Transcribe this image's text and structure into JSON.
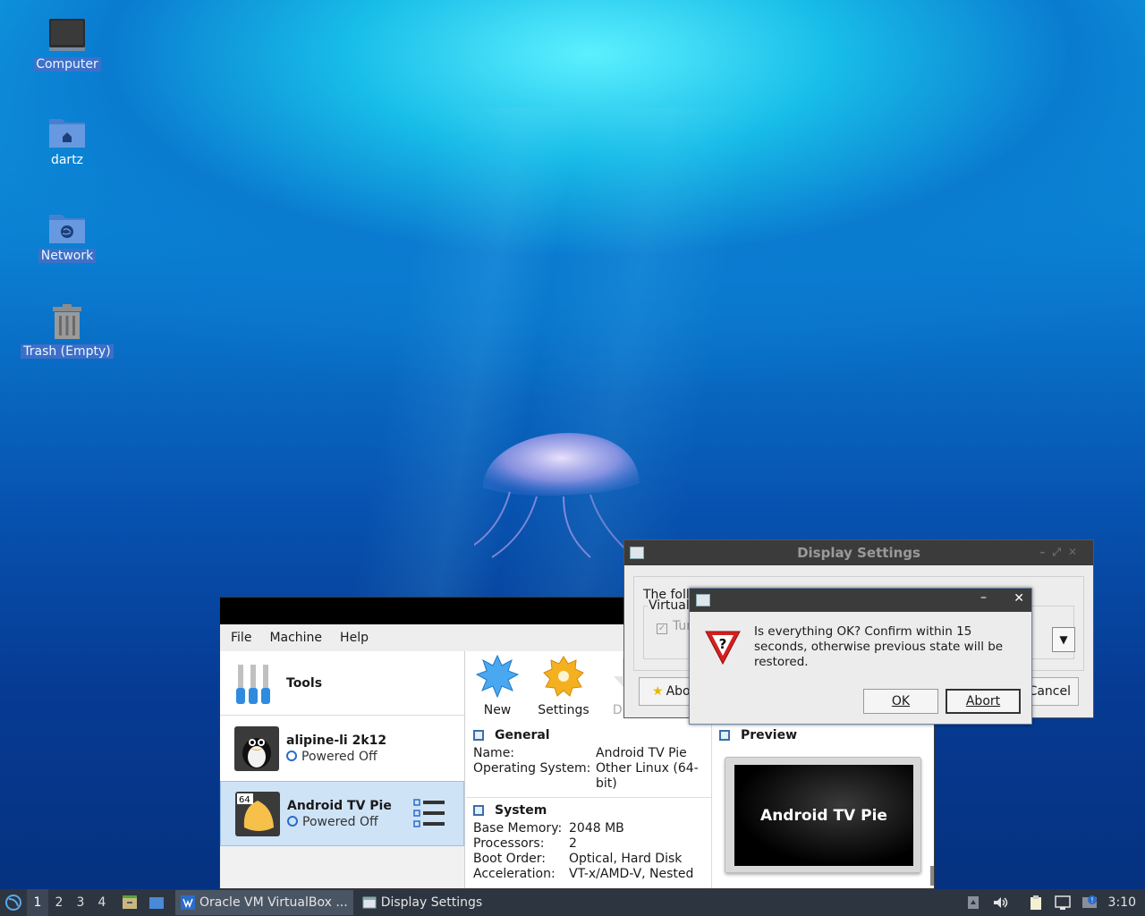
{
  "desktop": {
    "icons": [
      {
        "label": "Computer"
      },
      {
        "label": "dartz"
      },
      {
        "label": "Network"
      },
      {
        "label": "Trash (Empty)"
      }
    ]
  },
  "vbox": {
    "menu": [
      "File",
      "Machine",
      "Help"
    ],
    "tools_label": "Tools",
    "vms": [
      {
        "name": "alipine-li 2k12",
        "state": "Powered Off"
      },
      {
        "name": "Android TV Pie",
        "state": "Powered Off",
        "badge": "64"
      }
    ],
    "toolbar": {
      "new": "New",
      "settings": "Settings",
      "discard": "Disca"
    },
    "general": {
      "heading": "General",
      "name_label": "Name:",
      "name_value": "Android TV Pie",
      "os_label": "Operating System:",
      "os_value": "Other Linux (64-bit)"
    },
    "system": {
      "heading": "System",
      "mem_label": "Base Memory:",
      "mem_value": "2048 MB",
      "proc_label": "Processors:",
      "proc_value": "2",
      "boot_label": "Boot Order:",
      "boot_value": "Optical, Hard Disk",
      "accel_label": "Acceleration:",
      "accel_value": "VT-x/AMD-V, Nested"
    },
    "preview": {
      "heading": "Preview",
      "screen_text": "Android TV Pie"
    }
  },
  "display_settings": {
    "title": "Display Settings",
    "intro_text": "The foll",
    "group_label": "Virtual-",
    "checkbox_label": "Tur",
    "about_label": "Abo",
    "cancel_label": "Cancel"
  },
  "confirm": {
    "message": "Is everything OK? Confirm within 15 seconds, otherwise previous state will be restored.",
    "ok_label": "OK",
    "abort_label": "Abort"
  },
  "taskbar": {
    "workspaces": [
      "1",
      "2",
      "3",
      "4"
    ],
    "tasks": [
      {
        "label": "Oracle VM VirtualBox ...",
        "icon": "virtualbox-icon"
      },
      {
        "label": "Display Settings",
        "icon": "window-icon"
      }
    ],
    "clock": "3:10"
  },
  "colors": {
    "accent": "#2a6dc9",
    "selection": "#cfe3f7",
    "taskbar": "#2d3540",
    "titlebar": "#3b3b3b"
  }
}
